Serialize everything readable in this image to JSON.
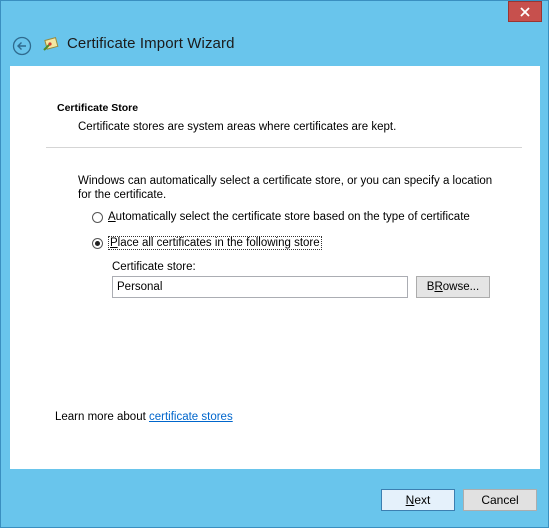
{
  "window": {
    "title": "Certificate Import Wizard"
  },
  "section": {
    "title": "Certificate Store",
    "description": "Certificate stores are system areas where certificates are kept."
  },
  "intro": "Windows can automatically select a certificate store, or you can specify a location for the certificate.",
  "options": [
    {
      "label_accel": "A",
      "label_rest": "utomatically select the certificate store based on the type of certificate",
      "selected": false
    },
    {
      "label_accel": "P",
      "label_rest": "lace all certificates in the following store",
      "selected": true
    }
  ],
  "store": {
    "label": "Certificate store:",
    "value": "Personal",
    "browse_accel": "R",
    "browse_pre": "B",
    "browse_post": "owse..."
  },
  "learn_more": {
    "prefix": "Learn more about ",
    "link": "certificate stores"
  },
  "buttons": {
    "next_accel": "N",
    "next_rest": "ext",
    "cancel": "Cancel"
  },
  "colors": {
    "window_frame": "#69c5ec",
    "close_button": "#c7504d",
    "link": "#0066cc"
  }
}
